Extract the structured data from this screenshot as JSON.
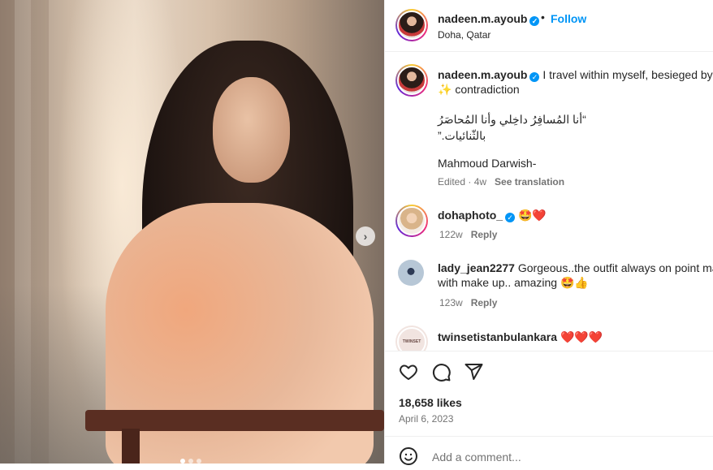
{
  "post": {
    "author": "nadeen.m.ayoub",
    "location": "Doha, Qatar",
    "follow_label": "Follow",
    "separator": "•",
    "next_arrow": "›",
    "caption": {
      "text_line1": "I travel within myself, besieged by",
      "text_line2": "contradiction",
      "emoji": "✨",
      "arabic_line1": "“أنا المُسافِرُ داخِلي وأنا المُحاصَرُ",
      "arabic_line2": "بالثّنائيات.”",
      "attribution": "Mahmoud Darwish-",
      "edited": "Edited · 4w",
      "see_translation": "See translation"
    },
    "likes": "18,658 likes",
    "date": "April 6, 2023",
    "add_comment_placeholder": "Add a comment..."
  },
  "comments": [
    {
      "user": "dohaphoto_",
      "text": "🤩❤️",
      "age": "122w",
      "reply": "Reply"
    },
    {
      "user": "lady_jean2277",
      "text_line1": "Gorgeous..the outfit always on point ma",
      "text_line2": "with make up.. amazing 🤩👍",
      "age": "123w",
      "reply": "Reply"
    },
    {
      "user": "twinsetistanbulankara",
      "text": "❤️❤️❤️",
      "avatar_text": "TWINSET"
    }
  ],
  "icons": [
    "heart-icon",
    "comment-icon",
    "share-icon",
    "emoji-icon",
    "verified-badge-icon",
    "chevron-right-icon"
  ],
  "colors": {
    "link": "#0095f6",
    "verified": "#0095f6",
    "muted": "#737373"
  }
}
